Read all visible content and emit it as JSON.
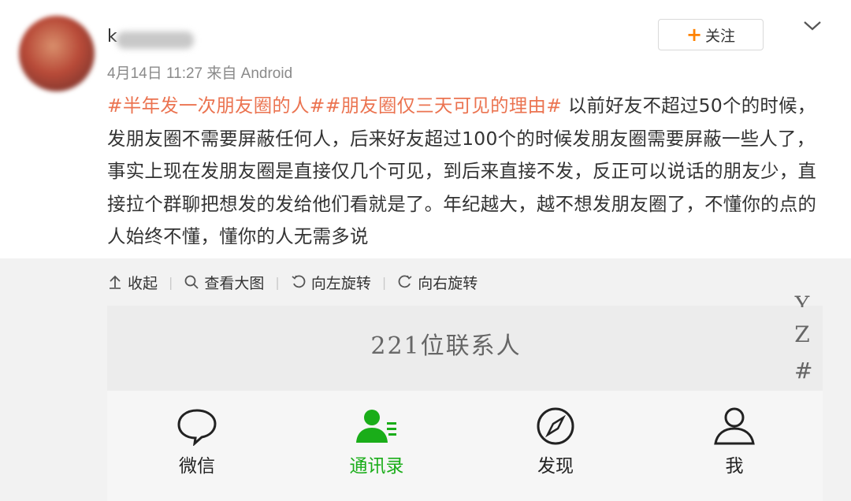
{
  "post": {
    "username_initial": "k",
    "meta": "4月14日 11:27 来自 Android",
    "follow_label": "关注",
    "hashtag1": "#半年发一次朋友圈的人#",
    "hashtag2": "#朋友圈仅三天可见的理由#",
    "body": " 以前好友不超过50个的时候，发朋友圈不需要屏蔽任何人，后来好友超过100个的时候发朋友圈需要屏蔽一些人了，事实上现在发朋友圈是直接仅几个可见，到后来直接不发，反正可以说话的朋友少，直接拉个群聊把想发的发给他们看就是了。年纪越大，越不想发朋友圈了，不懂你的点的人始终不懂，懂你的人无需多说"
  },
  "actions": {
    "collapse": "收起",
    "view_large": "查看大图",
    "rotate_left": "向左旋转",
    "rotate_right": "向右旋转"
  },
  "screenshot": {
    "contacts_count": "221位联系人",
    "index_letters": [
      "Y",
      "Z",
      "#"
    ],
    "tabs": [
      {
        "label": "微信",
        "icon": "chat-bubble-icon",
        "active": false
      },
      {
        "label": "通讯录",
        "icon": "contacts-icon",
        "active": true
      },
      {
        "label": "发现",
        "icon": "compass-icon",
        "active": false
      },
      {
        "label": "我",
        "icon": "person-icon",
        "active": false
      }
    ]
  },
  "colors": {
    "hashtag": "#eb7350",
    "follow_plus": "#ff8200",
    "wechat_green": "#1aad19"
  }
}
